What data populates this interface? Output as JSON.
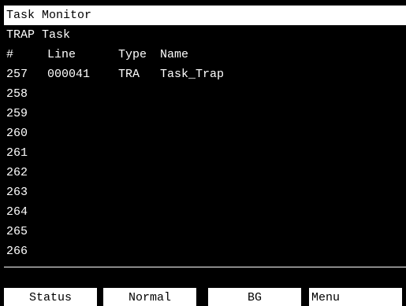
{
  "window": {
    "title": "Task Monitor"
  },
  "task": {
    "heading": "TRAP Task"
  },
  "table": {
    "headers": {
      "num": "#",
      "line": "Line",
      "type": "Type",
      "name": "Name"
    },
    "rows": [
      {
        "num": "257",
        "line": "000041",
        "type": "TRA",
        "name": "Task_Trap"
      },
      {
        "num": "258",
        "line": "",
        "type": "",
        "name": ""
      },
      {
        "num": "259",
        "line": "",
        "type": "",
        "name": ""
      },
      {
        "num": "260",
        "line": "",
        "type": "",
        "name": ""
      },
      {
        "num": "261",
        "line": "",
        "type": "",
        "name": ""
      },
      {
        "num": "262",
        "line": "",
        "type": "",
        "name": ""
      },
      {
        "num": "263",
        "line": "",
        "type": "",
        "name": ""
      },
      {
        "num": "264",
        "line": "",
        "type": "",
        "name": ""
      },
      {
        "num": "265",
        "line": "",
        "type": "",
        "name": ""
      },
      {
        "num": "266",
        "line": "",
        "type": "",
        "name": ""
      }
    ]
  },
  "softkeys": {
    "f1": "Status",
    "f2": "Normal",
    "f3": "BG",
    "f4": "Menu"
  }
}
